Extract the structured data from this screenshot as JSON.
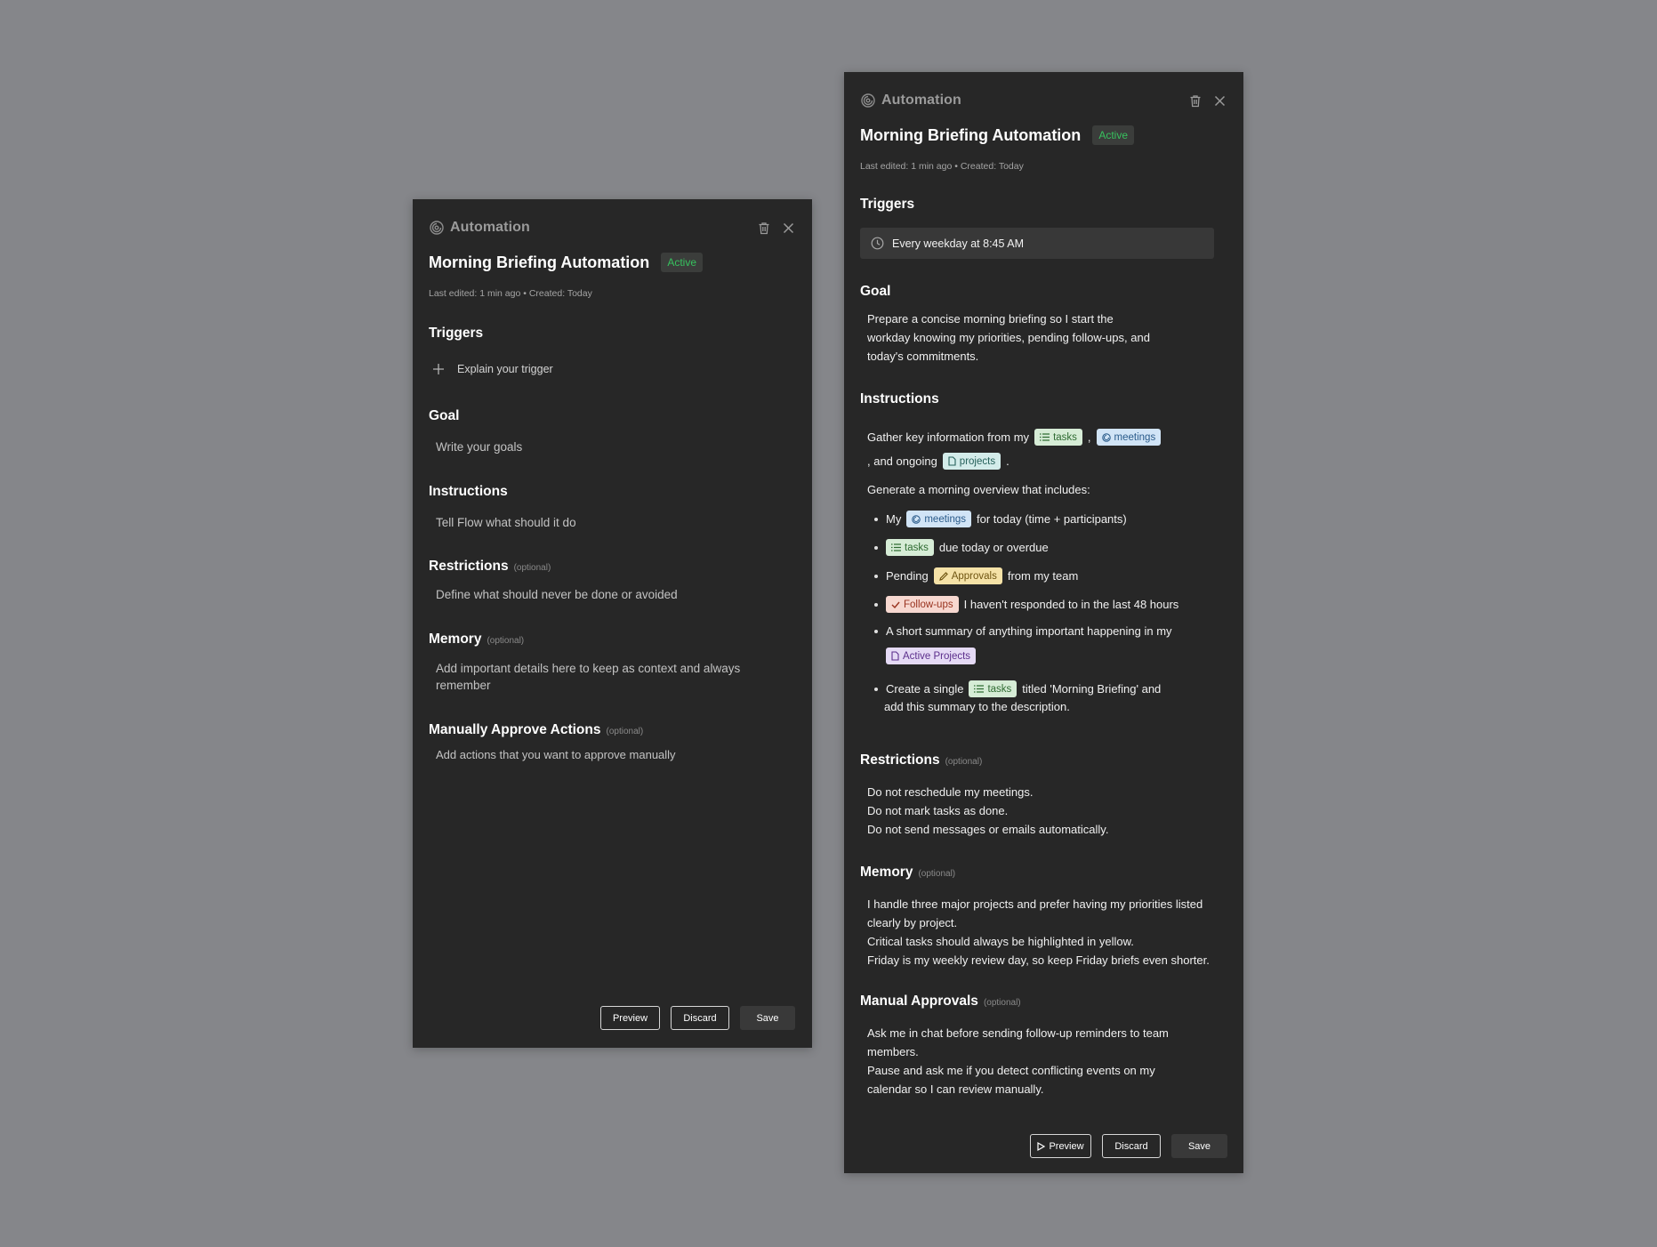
{
  "left_panel": {
    "app_title": "Automation",
    "title": "Morning Briefing Automation",
    "status": "Active",
    "last_edited": "Last edited: 1 min ago",
    "created": "• Created: Today",
    "triggers_heading": "Triggers",
    "trigger_placeholder": "Explain your trigger",
    "goal_heading": "Goal",
    "goal_placeholder": "Write your goals",
    "instructions_heading": "Instructions",
    "instructions_placeholder": "Tell Flow what should it do",
    "restrictions_heading": "Restrictions",
    "optional_label": "(optional)",
    "restrictions_placeholder": "Define what should never be done or avoided",
    "memory_heading": "Memory",
    "memory_placeholder_line1": "Add important details here to keep as context and always",
    "memory_placeholder_line2": "remember",
    "approve_heading": "Manually Approve Actions",
    "approve_placeholder": "Add actions that you want to approve manually",
    "preview_label": "Preview",
    "discard_label": "Discard",
    "save_label": "Save"
  },
  "right_panel": {
    "app_title": "Automation",
    "title": "Morning Briefing Automation",
    "status": "Active",
    "last_edited": "Last edited: 1 min ago",
    "created": "• Created: Today",
    "triggers_heading": "Triggers",
    "trigger_value": "Every weekday at 8:45 AM",
    "goal_heading": "Goal",
    "goal_lines": [
      "Prepare a concise morning briefing so I start the",
      "workday knowing my priorities, pending follow-ups, and",
      "today's commitments."
    ],
    "instructions_heading": "Instructions",
    "instructions": {
      "line1_text": "Gather key information from my",
      "chip_tasks": "tasks",
      "comma": ",",
      "chip_meetings": "meetings",
      "line2_text": ", and ongoing",
      "chip_projects": "projects",
      "period": ".",
      "overview_text": "Generate a morning overview that includes:",
      "b1_pre": "My",
      "b1_chip": "meetings",
      "b1_post": "for today (time + participants)",
      "b2_chip": "tasks",
      "b2_post": "due today or overdue",
      "b3_pre": "Pending",
      "b3_chip": "Approvals",
      "b3_post": "from my team",
      "b4_chip": "Follow-ups",
      "b4_post": "I haven't responded to in the last 48 hours",
      "b5_text": "A short summary of anything important happening in my",
      "b5_chip": "Active Projects",
      "b6_pre": "Create a single",
      "b6_chip": "tasks",
      "b6_post": "titled 'Morning Briefing' and",
      "b6_line2": "add this summary to the description."
    },
    "restrictions_heading": "Restrictions",
    "optional_label": "(optional)",
    "restrictions_lines": [
      "Do not reschedule my meetings.",
      "Do not mark tasks as done.",
      "Do not send messages or emails automatically."
    ],
    "memory_heading": "Memory",
    "memory_lines": [
      "I handle three major projects and prefer having my priorities listed",
      "clearly by project.",
      "Critical tasks should always be highlighted in yellow.",
      "Friday is my weekly review day, so keep Friday briefs even shorter."
    ],
    "approvals_heading": "Manual Approvals",
    "approvals_lines": [
      "Ask me in chat before sending follow-up reminders to team",
      "members.",
      "Pause and ask me  if you detect conflicting events on my",
      "calendar so I can review manually."
    ],
    "preview_label": "Preview",
    "discard_label": "Discard",
    "save_label": "Save"
  }
}
